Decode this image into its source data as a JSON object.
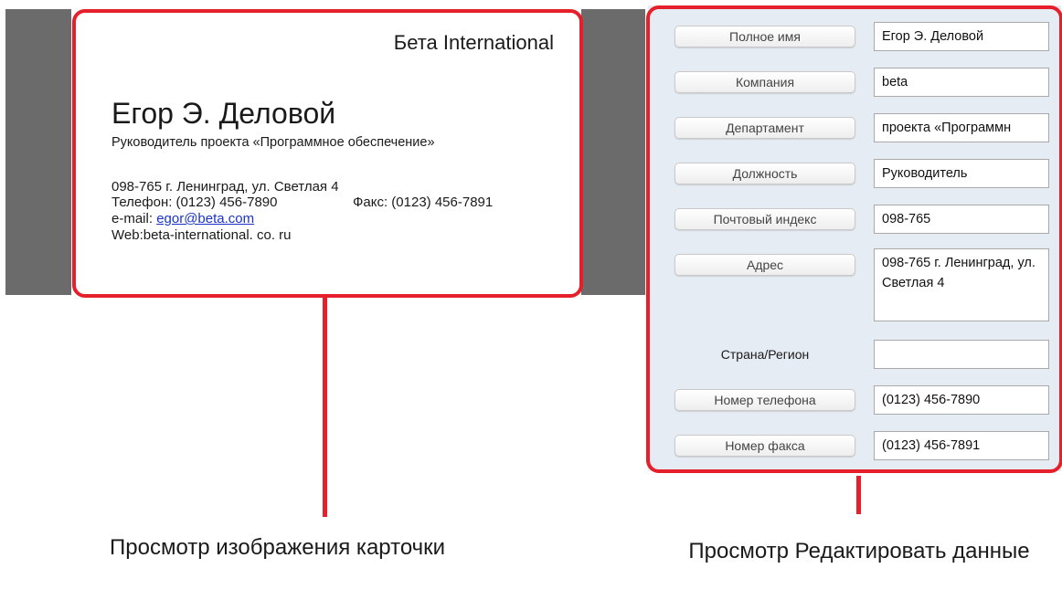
{
  "card": {
    "company": "Бета International",
    "person_name": "Егор Э. Деловой",
    "job_title": "Руководитель проекта «Программное обеспечение»",
    "address_line": "098-765 г. Ленинград, ул. Светлая 4",
    "phone_line": "Телефон: (0123) 456-7890",
    "fax_line": "Факс: (0123) 456-7891",
    "email_prefix": "e-mail: ",
    "email": "egor@beta.com",
    "web_line": "Web:beta-international. co. ru"
  },
  "edit_panel": {
    "fields": {
      "full_name": {
        "label": "Полное имя",
        "value": "Егор Э. Деловой"
      },
      "company": {
        "label": "Компания",
        "value": "beta"
      },
      "department": {
        "label": "Департамент",
        "value": "проекта «Программн"
      },
      "position": {
        "label": "Должность",
        "value": "Руководитель"
      },
      "postal_code": {
        "label": "Почтовый индекс",
        "value": "098-765"
      },
      "address": {
        "label": "Адрес",
        "value": "098-765 г. Ленинград, ул. Светлая 4"
      },
      "country": {
        "label": "Страна/Регион",
        "value": ""
      },
      "phone": {
        "label": "Номер телефона",
        "value": "(0123) 456-7890"
      },
      "fax": {
        "label": "Номер факса",
        "value": "(0123) 456-7891"
      }
    }
  },
  "captions": {
    "card_view": "Просмотр изображения карточки",
    "edit_view": "Просмотр Редактировать данные"
  },
  "colors": {
    "highlight": "#e5202a",
    "panel_bg": "#e6ecf3",
    "card_backdrop": "#6b6b6b",
    "link": "#1a34c9"
  }
}
